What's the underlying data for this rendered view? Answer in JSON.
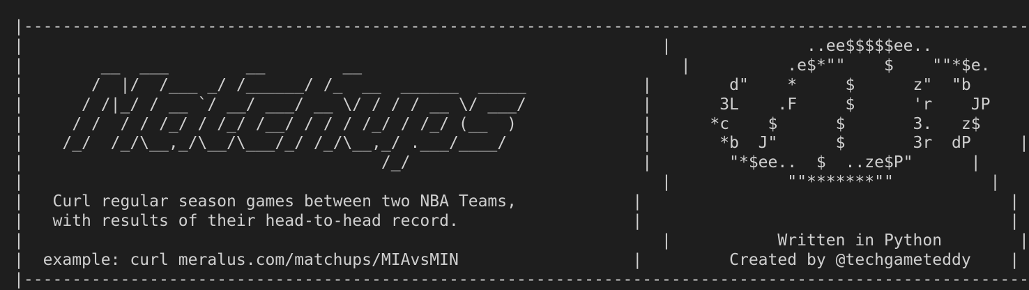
{
  "terminal": {
    "lines": [
      "|-----------------------------------------------------------------------------------------------------------|",
      "|                                                                  |              ..ee$$$$$ee..           |",
      "|        __  ___        __        __                                 |          .e$*\"\"    $    \"\"*$e.       |",
      "|       /  |/  /___ _/ /______/ /_  __  ______  _____            |        d\"    *     $      z\"  \"b      |",
      "|      / /|_/ / __ `/ __/ ___/ __ \\/ / / / __ \\/ ___/            |       3L    .F     $      'r    JP     |",
      "|     / /  / / /_/ / /_/ /__/ / / / /_/ / /_/ (__  )             |      *c    $      $       3.   z$     |",
      "|    /_/  /_/\\__,_/\\__/\\___/_/ /_/\\__,_/ .___/____/              |       *b  J\"      $       3r  dP     |",
      "|                                     /_/                        |        \"*$ee..  $  ..ze$P\"      |",
      "|                                                                  |            \"\"*******\"\"          |",
      "|   Curl regular season games between two NBA Teams,            |                                      |",
      "|   with results of their head-to-head record.                  |                                      |",
      "|                                                                  |           Written in Python        |",
      "|  example: curl meralus.com/matchups/MIAvsMIN                  |         Created by @techgameteddy    |",
      "|-----------------------------------------------------------------------------------------------------------|"
    ]
  }
}
